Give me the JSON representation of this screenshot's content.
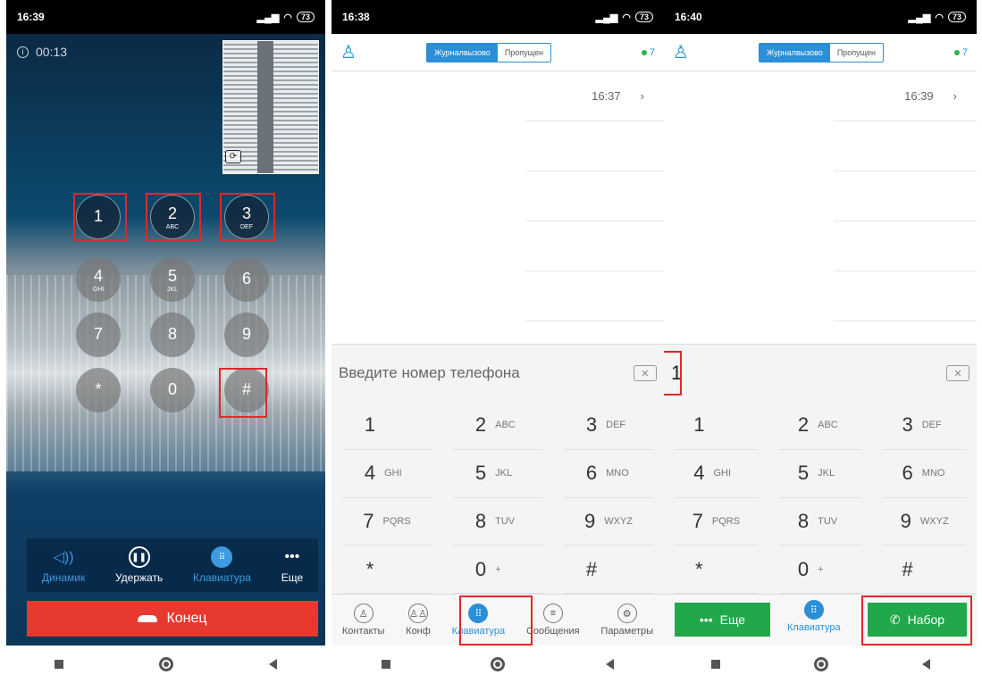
{
  "call_screen": {
    "status_time": "16:39",
    "battery": "73",
    "duration": "00:13",
    "keys": [
      {
        "d": "1",
        "l": ""
      },
      {
        "d": "2",
        "l": "ABC"
      },
      {
        "d": "3",
        "l": "DEF"
      },
      {
        "d": "4",
        "l": "GHI"
      },
      {
        "d": "5",
        "l": "JKL"
      },
      {
        "d": "6",
        "l": ""
      },
      {
        "d": "7",
        "l": ""
      },
      {
        "d": "8",
        "l": ""
      },
      {
        "d": "9",
        "l": ""
      },
      {
        "d": "*",
        "l": ""
      },
      {
        "d": "0",
        "l": ""
      },
      {
        "d": "#",
        "l": ""
      }
    ],
    "actions": {
      "speaker": "Динамик",
      "hold": "Удержать",
      "keypad": "Клавиатура",
      "more": "Еще"
    },
    "end_label": "Конец"
  },
  "dialer_screen": {
    "status_time": "16:38",
    "battery": "73",
    "tab_log": "Журналвызово",
    "tab_missed": "Пропущен",
    "count": "7",
    "log_time": "16:37",
    "placeholder": "Введите номер телефона",
    "keys": [
      {
        "d": "1",
        "l": ""
      },
      {
        "d": "2",
        "l": "ABC"
      },
      {
        "d": "3",
        "l": "DEF"
      },
      {
        "d": "4",
        "l": "GHI"
      },
      {
        "d": "5",
        "l": "JKL"
      },
      {
        "d": "6",
        "l": "MNO"
      },
      {
        "d": "7",
        "l": "PQRS"
      },
      {
        "d": "8",
        "l": "TUV"
      },
      {
        "d": "9",
        "l": "WXYZ"
      },
      {
        "d": "*",
        "l": ""
      },
      {
        "d": "0",
        "l": "+"
      },
      {
        "d": "#",
        "l": ""
      }
    ],
    "tabs": {
      "contacts": "Контакты",
      "conf": "Конф",
      "keypad": "Клавиатура",
      "messages": "Сообщения",
      "settings": "Параметры"
    }
  },
  "dialer_screen_2": {
    "status_time": "16:40",
    "battery": "73",
    "tab_log": "Журналвызово",
    "tab_missed": "Пропущен",
    "count": "7",
    "log_time": "16:39",
    "entered": "1",
    "more_label": "Еще",
    "keypad_label": "Клавиатура",
    "dial_label": "Набор"
  },
  "colors": {
    "accent": "#2a8fd6",
    "end_call": "#e8392f",
    "dial_green": "#21a84a",
    "highlight": "#e2262b"
  }
}
